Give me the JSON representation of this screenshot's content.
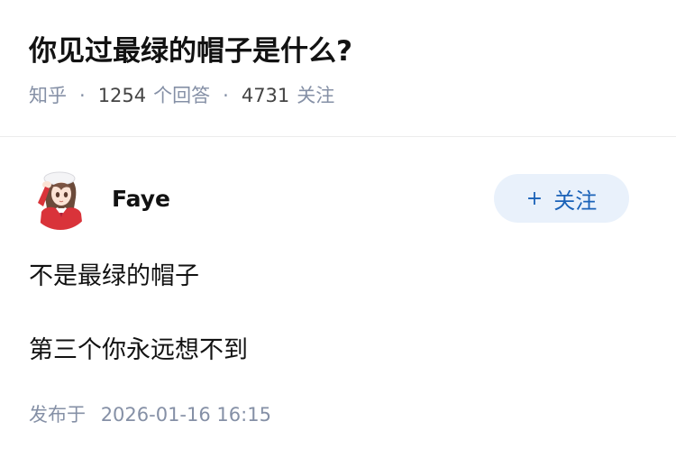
{
  "question": {
    "title": "你见过最绿的帽子是什么?",
    "source": "知乎",
    "answer_count": "1254",
    "answer_count_label": "个回答",
    "follower_count": "4731",
    "follower_label": "关注"
  },
  "answer": {
    "author": {
      "name": "Faye",
      "avatar_icon": "anime-girl-avatar"
    },
    "follow_button": {
      "icon": "plus-icon",
      "label": "关注",
      "color": "#1a62b8",
      "background": "#e9f1fb"
    },
    "paragraphs": [
      "不是最绿的帽子",
      "第三个你永远想不到"
    ],
    "publish": {
      "label": "发布于",
      "time": "2026-01-16 16:15"
    }
  }
}
